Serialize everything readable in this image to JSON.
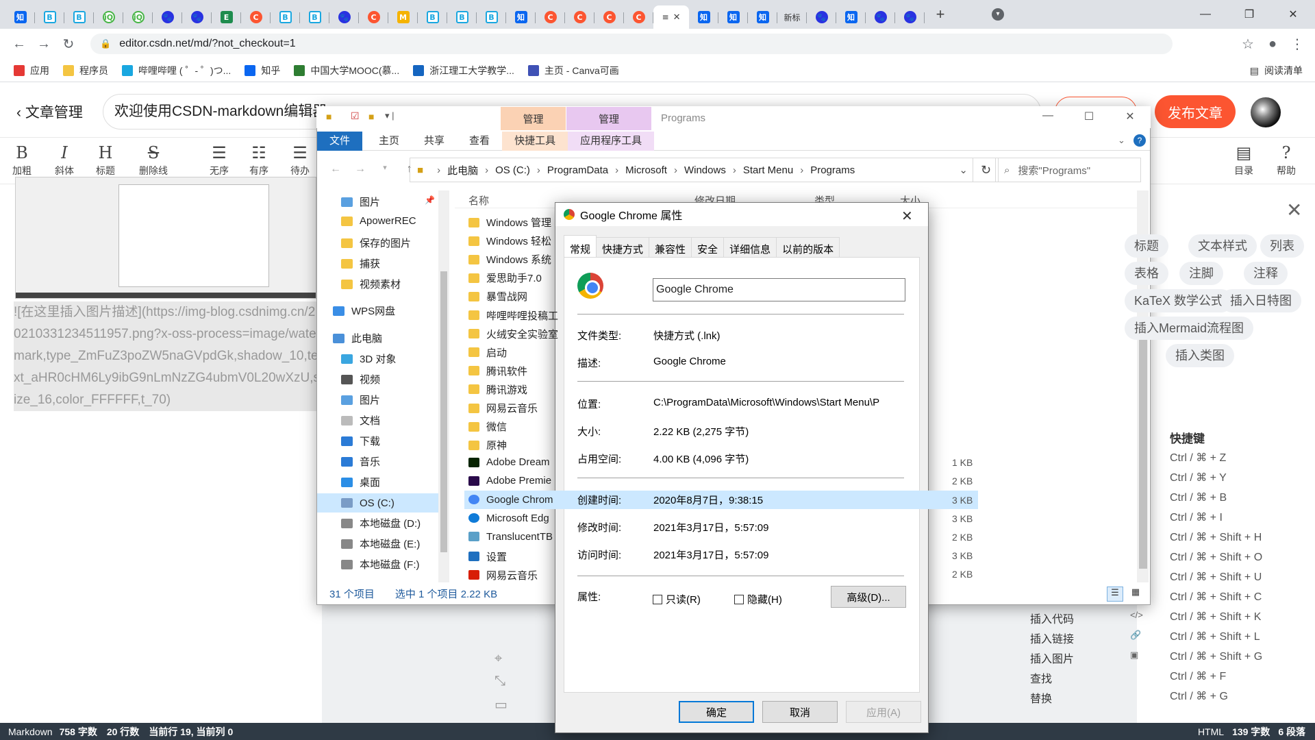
{
  "browser": {
    "tabs": [
      {
        "icon": "zhihu",
        "label": "知"
      },
      {
        "icon": "bilibili",
        "label": "B"
      },
      {
        "icon": "bilibili",
        "label": "B"
      },
      {
        "icon": "iqiyi",
        "label": "iQ"
      },
      {
        "icon": "iqiyi",
        "label": "iQ"
      },
      {
        "icon": "baidu",
        "label": "🐾"
      },
      {
        "icon": "baidu",
        "label": "🐾"
      },
      {
        "icon": "excel",
        "label": "E"
      },
      {
        "icon": "csdn",
        "label": "C"
      },
      {
        "icon": "bilibili",
        "label": "B"
      },
      {
        "icon": "bilibili",
        "label": "B"
      },
      {
        "icon": "baidu",
        "label": "🐾"
      },
      {
        "icon": "csdn",
        "label": "C"
      },
      {
        "icon": "mz",
        "label": "M"
      },
      {
        "icon": "bilibili",
        "label": "B"
      },
      {
        "icon": "bilibili",
        "label": "B"
      },
      {
        "icon": "bilibili",
        "label": "B"
      },
      {
        "icon": "zhihu",
        "label": "知"
      },
      {
        "icon": "csdn",
        "label": "C"
      },
      {
        "icon": "csdn",
        "label": "C"
      },
      {
        "icon": "csdn",
        "label": "C"
      },
      {
        "icon": "csdn",
        "label": "C"
      }
    ],
    "active_tab_label": "≡",
    "tabs_after": [
      {
        "icon": "zhihu",
        "label": "知"
      },
      {
        "icon": "zhihu",
        "label": "知"
      },
      {
        "icon": "zhihu",
        "label": "知"
      },
      {
        "icon": "txt",
        "label": "新标"
      },
      {
        "icon": "baidu",
        "label": "🐾"
      },
      {
        "icon": "zhihu",
        "label": "知"
      },
      {
        "icon": "baidu",
        "label": "🐾"
      },
      {
        "icon": "baidu",
        "label": "🐾"
      }
    ],
    "url": "editor.csdn.net/md/?not_checkout=1",
    "bookmarks": [
      {
        "label": "应用",
        "color": "#e53935"
      },
      {
        "label": "程序员",
        "color": "#f4c542"
      },
      {
        "label": "哔哩哔哩 ( ゜- ゜)つ...",
        "color": "#19a7e0"
      },
      {
        "label": "知乎",
        "color": "#0a66f0"
      },
      {
        "label": "中国大学MOOC(慕...",
        "color": "#2e7d32"
      },
      {
        "label": "浙江理工大学教学...",
        "color": "#1565c0"
      },
      {
        "label": "主页 - Canva可画",
        "color": "#3f51b5"
      }
    ],
    "reading_list": "阅读清单"
  },
  "editor": {
    "back_label": "文章管理",
    "title_value": "欢迎使用CSDN-markdown编辑器",
    "publish_label": "发布文章",
    "tools": [
      {
        "glyph": "B",
        "label": "加粗"
      },
      {
        "glyph": "I",
        "label": "斜体"
      },
      {
        "glyph": "H",
        "label": "标题"
      },
      {
        "glyph": "S",
        "label": "删除线"
      },
      {
        "glyph": "☰",
        "label": "无序"
      },
      {
        "glyph": "☷",
        "label": "有序"
      },
      {
        "glyph": "☰",
        "label": "待办"
      }
    ],
    "right_tools": [
      {
        "glyph": "▤",
        "label": "目录"
      },
      {
        "glyph": "?",
        "label": "帮助"
      }
    ],
    "image_markdown": "![在这里插入图片描述](https://img-blog.csdnimg.cn/20210331234511957.png?x-oss-process=image/watermark,type_ZmFuZ3poZW5naGVpdGk,shadow_10,text_aHR0cHM6Ly9ibG9nLmNzZG4ubmV0L20wXzU,size_16,color_FFFFFF,t_70)",
    "syntax_chips": [
      "标题",
      "文本样式",
      "列表",
      "表格",
      "注脚",
      "注释",
      "KaTeX 数学公式",
      "插入日特图",
      "插入Mermaid流程图",
      "插入类图"
    ],
    "shortcuts_title": "快捷键",
    "shortcuts": [
      "Ctrl / ⌘ + Z",
      "Ctrl / ⌘ + Y",
      "Ctrl / ⌘ + B",
      "Ctrl / ⌘ + I",
      "Ctrl / ⌘ + Shift + H",
      "Ctrl / ⌘ + Shift + O",
      "Ctrl / ⌘ + Shift + U",
      "Ctrl / ⌘ + Shift + C",
      "Ctrl / ⌘ + Shift + K",
      "Ctrl / ⌘ + Shift + L",
      "Ctrl / ⌘ + Shift + G",
      "Ctrl / ⌘ + F",
      "Ctrl / ⌘ + G"
    ],
    "shortcut_labels": [
      "插入代码",
      "插入链接",
      "插入图片",
      "查找",
      "替换"
    ],
    "status": {
      "mode": "Markdown",
      "chars": "758 字数",
      "lines": "20 行数",
      "cursor": "当前行 19, 当前列 0"
    },
    "status_right": {
      "mode": "HTML",
      "chars": "139 字数",
      "paras": "6 段落"
    }
  },
  "explorer": {
    "ctx_tab1": "管理",
    "ctx_tab2": "管理",
    "window_title": "Programs",
    "ribbon_tabs": [
      "文件",
      "主页",
      "共享",
      "查看",
      "快捷工具",
      "应用程序工具"
    ],
    "breadcrumb": [
      "此电脑",
      "OS (C:)",
      "ProgramData",
      "Microsoft",
      "Windows",
      "Start Menu",
      "Programs"
    ],
    "search_placeholder": "搜索\"Programs\"",
    "nav_items": [
      {
        "label": "图片",
        "color": "#5aa0e0"
      },
      {
        "label": "ApowerREC",
        "color": "#f4c542"
      },
      {
        "label": "保存的图片",
        "color": "#f4c542"
      },
      {
        "label": "捕获",
        "color": "#f4c542"
      },
      {
        "label": "视频素材",
        "color": "#f4c542"
      },
      {
        "label": "WPS网盘",
        "color": "#3a8ee6"
      },
      {
        "label": "此电脑",
        "color": "#4a90d9"
      },
      {
        "label": "3D 对象",
        "color": "#3aa6e0"
      },
      {
        "label": "视频",
        "color": "#555"
      },
      {
        "label": "图片",
        "color": "#5aa0e0"
      },
      {
        "label": "文档",
        "color": "#bbb"
      },
      {
        "label": "下载",
        "color": "#2b7bd6"
      },
      {
        "label": "音乐",
        "color": "#2b7bd6"
      },
      {
        "label": "桌面",
        "color": "#2b8ee6"
      },
      {
        "label": "OS (C:)",
        "color": "#7a9cc6"
      },
      {
        "label": "本地磁盘 (D:)",
        "color": "#888"
      },
      {
        "label": "本地磁盘 (E:)",
        "color": "#888"
      },
      {
        "label": "本地磁盘 (F:)",
        "color": "#888"
      }
    ],
    "columns": [
      "名称",
      "修改日期",
      "类型",
      "大小"
    ],
    "files": [
      {
        "name": "Windows 管理",
        "kind": "folder",
        "size": ""
      },
      {
        "name": "Windows 轻松",
        "kind": "folder",
        "size": ""
      },
      {
        "name": "Windows 系统",
        "kind": "folder",
        "size": ""
      },
      {
        "name": "爱思助手7.0",
        "kind": "folder",
        "size": ""
      },
      {
        "name": "暴雪战网",
        "kind": "folder",
        "size": ""
      },
      {
        "name": "哔哩哔哩投稿工",
        "kind": "folder",
        "size": ""
      },
      {
        "name": "火绒安全实验室",
        "kind": "folder",
        "size": ""
      },
      {
        "name": "启动",
        "kind": "folder",
        "size": ""
      },
      {
        "name": "腾讯软件",
        "kind": "folder",
        "size": ""
      },
      {
        "name": "腾讯游戏",
        "kind": "folder",
        "size": ""
      },
      {
        "name": "网易云音乐",
        "kind": "folder",
        "size": ""
      },
      {
        "name": "微信",
        "kind": "folder",
        "size": ""
      },
      {
        "name": "原神",
        "kind": "folder",
        "size": ""
      },
      {
        "name": "Adobe Dream",
        "kind": "dw",
        "size": "1 KB"
      },
      {
        "name": "Adobe Premie",
        "kind": "pr",
        "size": "2 KB"
      },
      {
        "name": "Google Chrom",
        "kind": "chrome",
        "size": "3 KB"
      },
      {
        "name": "Microsoft Edg",
        "kind": "edge",
        "size": "3 KB"
      },
      {
        "name": "TranslucentTB",
        "kind": "tb",
        "size": "2 KB"
      },
      {
        "name": "设置",
        "kind": "settings",
        "size": "3 KB"
      },
      {
        "name": "网易云音乐",
        "kind": "netease",
        "size": "2 KB"
      }
    ],
    "status_count": "31 个项目",
    "status_selected": "选中 1 个项目  2.22 KB"
  },
  "dialog": {
    "title": "Google Chrome 属性",
    "tabs": [
      "常规",
      "快捷方式",
      "兼容性",
      "安全",
      "详细信息",
      "以前的版本"
    ],
    "name": "Google Chrome",
    "rows_a": [
      {
        "label": "文件类型:",
        "value": "快捷方式 (.lnk)"
      },
      {
        "label": "描述:",
        "value": "Google Chrome"
      }
    ],
    "rows_b": [
      {
        "label": "位置:",
        "value": "C:\\ProgramData\\Microsoft\\Windows\\Start Menu\\P"
      },
      {
        "label": "大小:",
        "value": "2.22 KB (2,275 字节)"
      },
      {
        "label": "占用空间:",
        "value": "4.00 KB (4,096 字节)"
      }
    ],
    "rows_c": [
      {
        "label": "创建时间:",
        "value": "2020年8月7日，9:38:15"
      },
      {
        "label": "修改时间:",
        "value": "2021年3月17日，5:57:09"
      },
      {
        "label": "访问时间:",
        "value": "2021年3月17日，5:57:09"
      }
    ],
    "attr_label": "属性:",
    "readonly_label": "只读(R)",
    "hidden_label": "隐藏(H)",
    "advanced_label": "高级(D)...",
    "ok_label": "确定",
    "cancel_label": "取消",
    "apply_label": "应用(A)"
  }
}
